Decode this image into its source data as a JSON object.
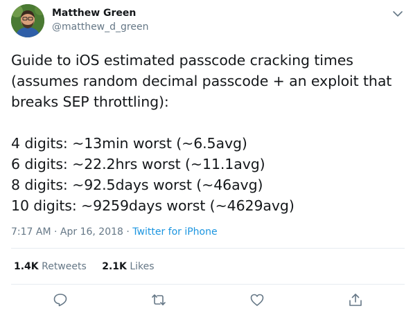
{
  "author": {
    "display_name": "Matthew Green",
    "handle": "@matthew_d_green"
  },
  "tweet": {
    "lines": [
      "Guide to iOS estimated passcode cracking times",
      "(assumes random decimal passcode + an exploit that",
      "breaks SEP throttling):",
      "",
      "4 digits: ~13min worst (~6.5avg)",
      "6 digits: ~22.2hrs worst (~11.1avg)",
      "8 digits: ~92.5days worst (~46avg)",
      "10 digits: ~9259days worst (~4629avg)"
    ],
    "timestamp": "7:17 AM · Apr 16, 2018",
    "separator": " · ",
    "source": "Twitter for iPhone"
  },
  "stats": {
    "retweets_count": "1.4K",
    "retweets_label": "Retweets",
    "likes_count": "2.1K",
    "likes_label": "Likes"
  },
  "icons": {
    "caret": "chevron-down-icon",
    "reply": "reply-icon",
    "retweet": "retweet-icon",
    "like": "heart-icon",
    "share": "share-icon"
  },
  "colors": {
    "text": "#14171a",
    "secondary": "#657786",
    "link": "#1b95e0",
    "divider": "#e6ecf0"
  }
}
